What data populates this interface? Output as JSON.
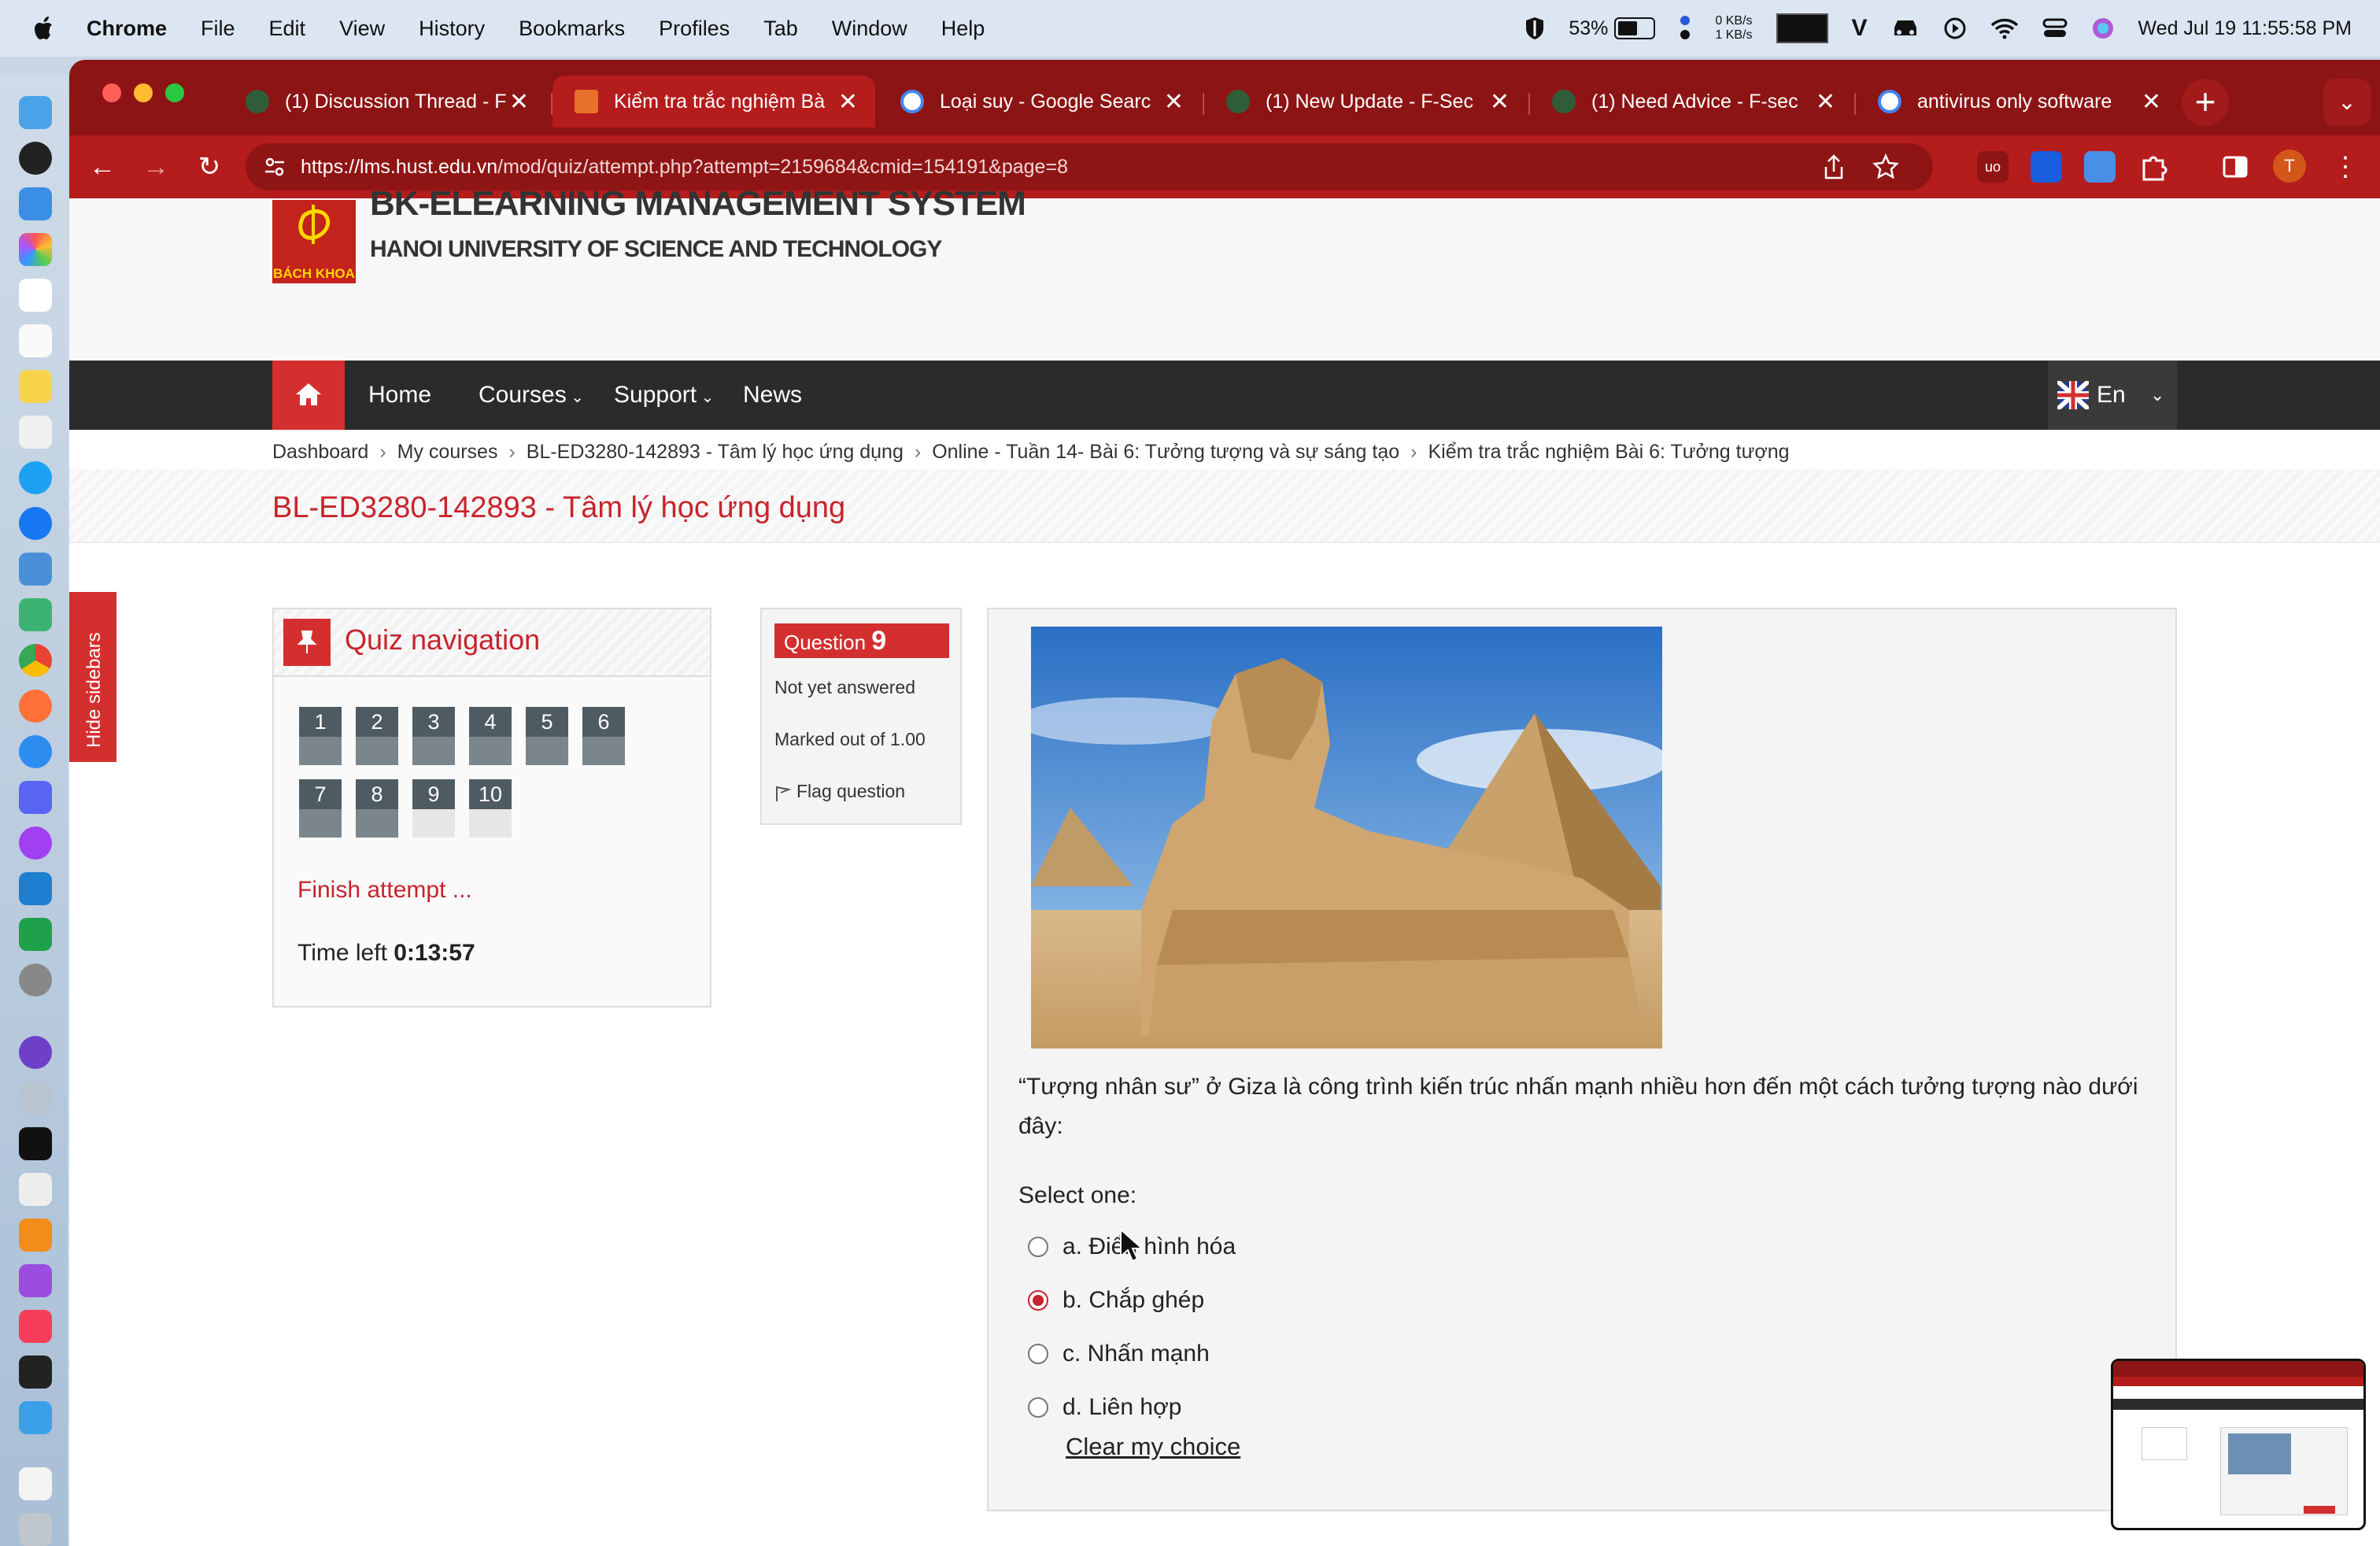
{
  "menubar": {
    "app": "Chrome",
    "items": [
      "File",
      "Edit",
      "View",
      "History",
      "Bookmarks",
      "Profiles",
      "Tab",
      "Window",
      "Help"
    ],
    "battery_pct": "53%",
    "net_up": "0 KB/s",
    "net_down": "1 KB/s",
    "datetime": "Wed Jul 19  11:55:58 PM"
  },
  "tabs": [
    {
      "title": "(1) Discussion Thread - F",
      "favicon_color": "#2f5d3a"
    },
    {
      "title": "Kiểm tra trắc nghiệm Bà",
      "favicon_color": "#e8702a",
      "active": true
    },
    {
      "title": "Loại suy - Google Searc",
      "favicon_color": "#ffffff"
    },
    {
      "title": "(1) New Update - F-Sec",
      "favicon_color": "#2f5d3a"
    },
    {
      "title": "(1) Need Advice - F-sec",
      "favicon_color": "#2f5d3a"
    },
    {
      "title": "antivirus only software",
      "favicon_color": "#ffffff"
    }
  ],
  "toolbar": {
    "url_host": "https://lms.hust.edu.vn",
    "url_path": "/mod/quiz/attempt.php?attempt=2159684&cmid=154191&page=8",
    "avatar_letter": "T"
  },
  "site": {
    "title": "BK-ELEARNING MANAGEMENT SYSTEM",
    "university": "HANOI UNIVERSITY OF SCIENCE AND TECHNOLOGY",
    "logo_text": "BÁCH KHOA"
  },
  "nav": {
    "home": "Home",
    "courses": "Courses",
    "support": "Support",
    "news": "News",
    "lang": "En"
  },
  "breadcrumb": [
    "Dashboard",
    "My courses",
    "BL-ED3280-142893 - Tâm lý học ứng dụng",
    "Online - Tuần 14- Bài 6: Tưởng tượng và sự sáng tạo",
    "Kiểm tra trắc nghiệm Bài 6: Tưởng tượng"
  ],
  "course_title": "BL-ED3280-142893 - Tâm lý học ứng dụng",
  "hide_sidebars": "Hide sidebars",
  "quiz_nav": {
    "title": "Quiz navigation",
    "questions": [
      "1",
      "2",
      "3",
      "4",
      "5",
      "6",
      "7",
      "8",
      "9",
      "10"
    ],
    "finish": "Finish attempt ...",
    "time_label": "Time left ",
    "time_value": "0:13:57"
  },
  "question_info": {
    "label": "Question ",
    "number": "9",
    "state": "Not yet answered",
    "marks": "Marked out of 1.00",
    "flag": "Flag question"
  },
  "question": {
    "text": "“Tượng nhân sư” ở Giza là công trình kiến trúc nhấn mạnh nhiều hơn đến một cách tưởng tượng nào dưới đây:",
    "select_one": "Select one:",
    "options": [
      {
        "label": "a. Điển hình hóa",
        "selected": false
      },
      {
        "label": "b. Chắp ghép",
        "selected": true
      },
      {
        "label": "c. Nhấn mạnh",
        "selected": false
      },
      {
        "label": "d. Liên hợp",
        "selected": false
      }
    ],
    "clear": "Clear my choice"
  },
  "colors": {
    "brand_red": "#c8232c",
    "tab_strip": "#8d1414",
    "navbar": "#2b2b2b"
  }
}
